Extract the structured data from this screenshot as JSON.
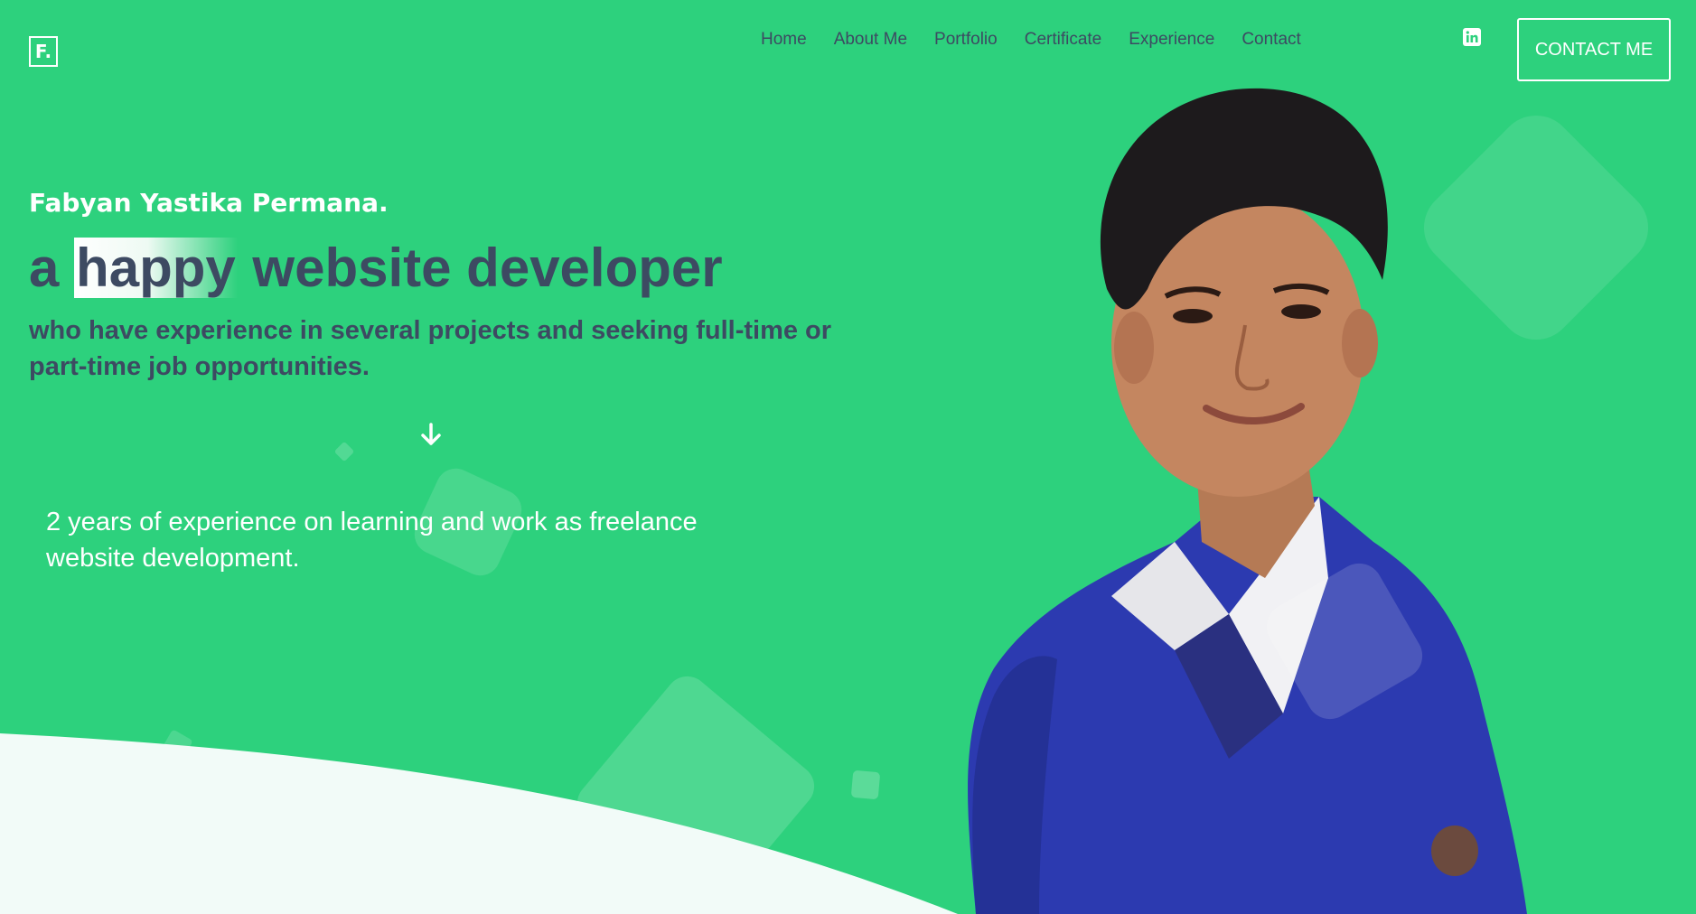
{
  "header": {
    "logo_text": "F.",
    "nav": [
      "Home",
      "About Me",
      "Portfolio",
      "Certificate",
      "Experience",
      "Contact"
    ],
    "social_icon": "linkedin-icon",
    "contact_button": "CONTACT ME"
  },
  "hero": {
    "name": "Fabyan Yastika Permana.",
    "headline_prefix": "a",
    "headline_highlight": "happy",
    "headline_suffix": "website developer",
    "subtitle": "who have experience in several projects and seeking full-time or part-time job opportunities.",
    "scroll_icon": "arrow-down-icon",
    "experience": "2 years of experience on learning and work as freelance website development."
  },
  "colors": {
    "background": "#2dd17d",
    "text_dark": "#3d4a62",
    "white": "#ffffff",
    "wave": "#f2fbf8"
  }
}
